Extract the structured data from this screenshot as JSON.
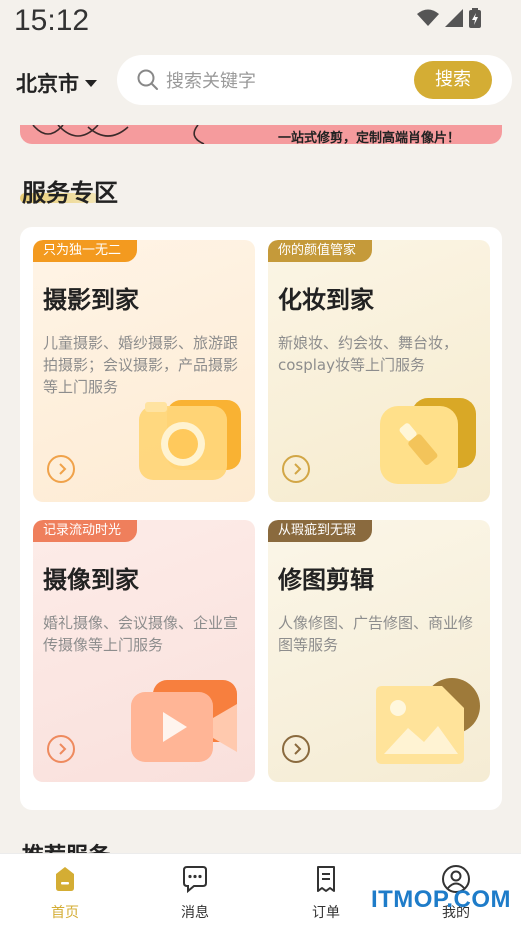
{
  "status": {
    "time": "15:12"
  },
  "header": {
    "city": "北京市",
    "search_placeholder": "搜索关键字",
    "search_button": "搜索"
  },
  "banner": {
    "text": "一站式修剪，定制高端肖像片！"
  },
  "section": {
    "title": "服务专区"
  },
  "cards": [
    {
      "tag": "只为独一无二",
      "title": "摄影到家",
      "desc": "儿童摄影、婚纱摄影、旅游跟拍摄影；会议摄影，产品摄影等上门服务"
    },
    {
      "tag": "你的颜值管家",
      "title": "化妆到家",
      "desc": "新娘妆、约会妆、舞台妆，cosplay妆等上门服务"
    },
    {
      "tag": "记录流动时光",
      "title": "摄像到家",
      "desc": "婚礼摄像、会议摄像、企业宣传摄像等上门服务"
    },
    {
      "tag": "从瑕疵到无瑕",
      "title": "修图剪辑",
      "desc": "人像修图、广告修图、商业修图等服务"
    }
  ],
  "next_section": {
    "title": "推荐服务"
  },
  "tabbar": {
    "items": [
      {
        "label": "首页",
        "icon": "home-icon",
        "active": true
      },
      {
        "label": "消息",
        "icon": "message-icon"
      },
      {
        "label": "订单",
        "icon": "order-icon"
      },
      {
        "label": "我的",
        "icon": "profile-icon"
      }
    ]
  },
  "watermark": "ITMOP.COM",
  "colors": {
    "accent": "#d4ad34",
    "banner": "#f59b9d",
    "background": "#f4f1ec"
  }
}
